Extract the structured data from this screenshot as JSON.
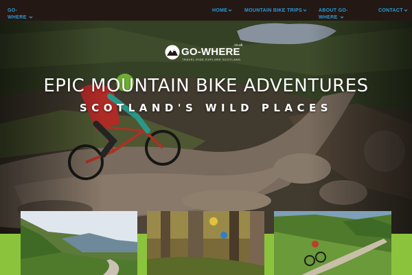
{
  "nav": {
    "brand": "GO-WHERE",
    "items": [
      {
        "label": "HOME"
      },
      {
        "label": "MOUNTAIN BIKE TRIPS"
      },
      {
        "label": "ABOUT GO-WHERE"
      },
      {
        "label": "CONTACT"
      }
    ],
    "link_color": "#2a9bd6",
    "bar_color": "#241814"
  },
  "logo": {
    "wordmark": "GO-WHERE",
    "domain": ".co.uk",
    "tagline": "TRAVEL  RIDE  EXPLORE  SCOTLAND"
  },
  "hero": {
    "title": "EPIC MOUNTAIN BIKE ADVENTURES",
    "subtitle": "SCOTLAND'S WILD PLACES"
  },
  "gallery": {
    "accent_color": "#8cc33d",
    "cards": [
      {
        "icon": "glen-valley-photo"
      },
      {
        "icon": "forest-riders-photo"
      },
      {
        "icon": "hill-trail-rider-photo"
      }
    ]
  }
}
